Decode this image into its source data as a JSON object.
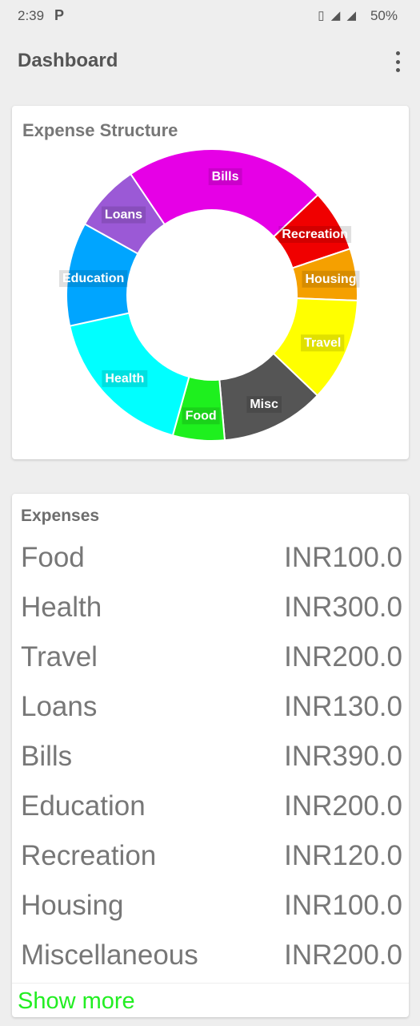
{
  "status_bar": {
    "time": "2:39",
    "notification_icon": "P",
    "battery": "50%",
    "icons": [
      "vibrate-icon",
      "signal-icon",
      "4g-signal-icon"
    ]
  },
  "app_bar": {
    "title": "Dashboard",
    "menu_icon": "overflow-menu-icon"
  },
  "chart_card": {
    "title": "Expense Structure"
  },
  "chart_data": {
    "type": "pie",
    "title": "Expense Structure",
    "slices": [
      {
        "label": "Bills",
        "value": 390,
        "color": "#e600e6"
      },
      {
        "label": "Recreation",
        "value": 120,
        "color": "#f00000"
      },
      {
        "label": "Housing",
        "value": 100,
        "color": "#f5a000"
      },
      {
        "label": "Travel",
        "value": 200,
        "color": "#ffff00"
      },
      {
        "label": "Misc",
        "value": 200,
        "color": "#555555"
      },
      {
        "label": "Food",
        "value": 100,
        "color": "#1ef01e"
      },
      {
        "label": "Health",
        "value": 300,
        "color": "#00ffff"
      },
      {
        "label": "Education",
        "value": 200,
        "color": "#00a5ff"
      },
      {
        "label": "Loans",
        "value": 130,
        "color": "#9b59d6"
      }
    ],
    "legend": "none"
  },
  "expenses_card": {
    "title": "Expenses",
    "items": [
      {
        "name": "Food",
        "amount": "INR100.0"
      },
      {
        "name": "Health",
        "amount": "INR300.0"
      },
      {
        "name": "Travel",
        "amount": "INR200.0"
      },
      {
        "name": "Loans",
        "amount": "INR130.0"
      },
      {
        "name": "Bills",
        "amount": "INR390.0"
      },
      {
        "name": "Education",
        "amount": "INR200.0"
      },
      {
        "name": "Recreation",
        "amount": "INR120.0"
      },
      {
        "name": "Housing",
        "amount": "INR100.0"
      },
      {
        "name": "Miscellaneous",
        "amount": "INR200.0"
      }
    ],
    "show_more_label": "Show more",
    "show_more_color": "#22ee22"
  }
}
